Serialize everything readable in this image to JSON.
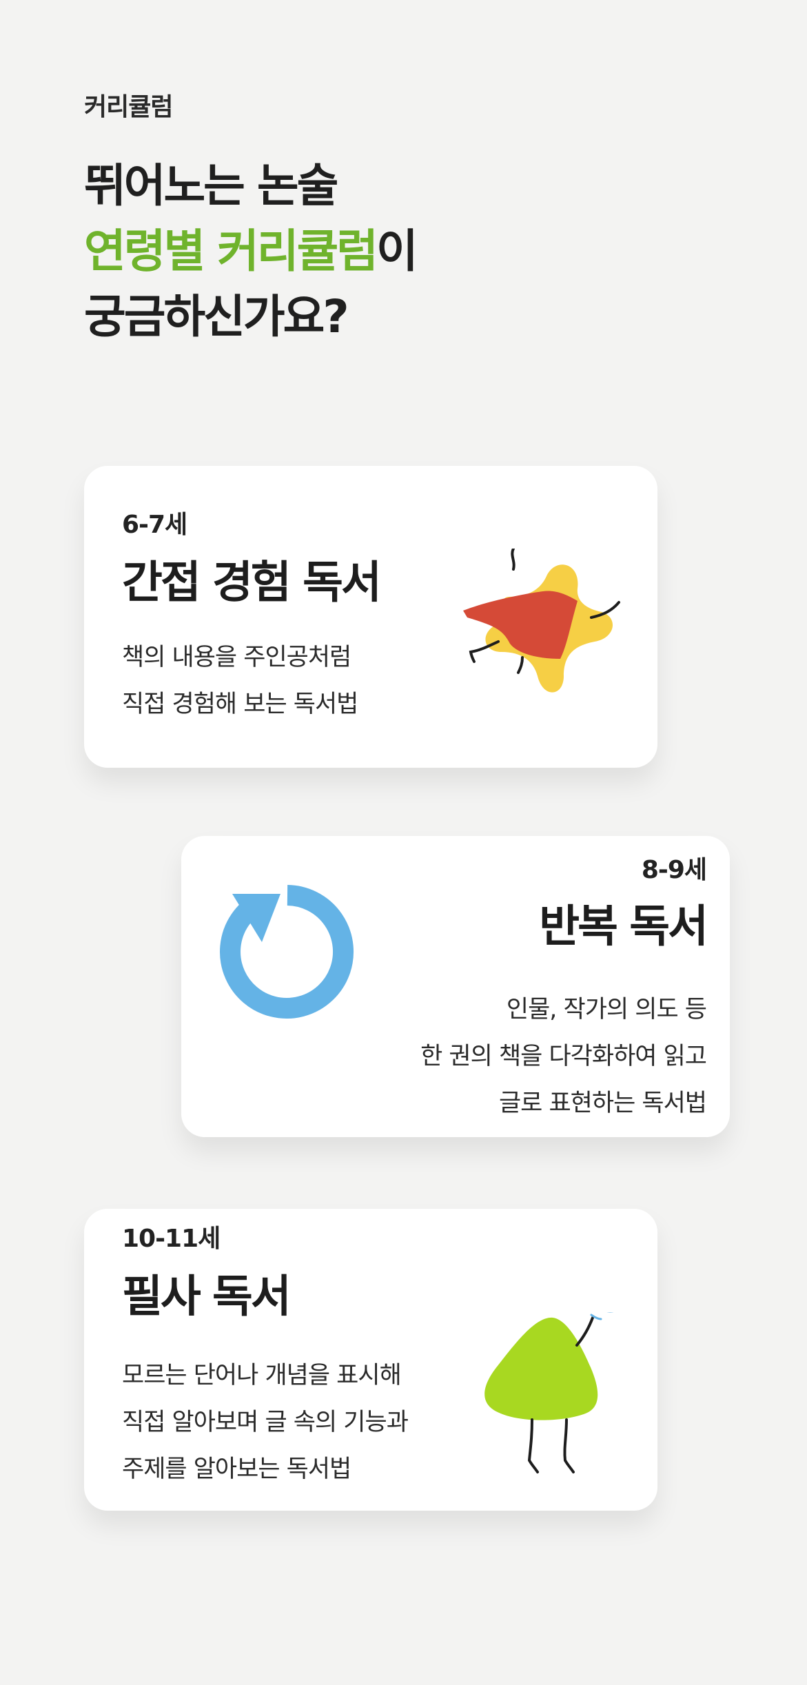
{
  "header": {
    "eyebrow": "커리큘럼",
    "line1": "뛰어노는 논술",
    "line2_accent": "연령별 커리큘럼",
    "line2_rest": "이",
    "line3": "궁금하신가요?",
    "accent_color": "#6fb32c"
  },
  "cards": [
    {
      "age": "6-7세",
      "title": "간접 경험 독서",
      "desc": [
        "책의 내용을 주인공처럼",
        "직접 경험해 보는 독서법"
      ],
      "icon": "star-character-icon"
    },
    {
      "age": "8-9세",
      "title": "반복 독서",
      "desc": [
        "인물, 작가의 의도 등",
        "한 권의 책을 다각화하여 읽고",
        "글로 표현하는 독서법"
      ],
      "icon": "repeat-arrow-icon"
    },
    {
      "age": "10-11세",
      "title": "필사 독서",
      "desc": [
        "모르는 단어나 개념을 표시해",
        "직접 알아보며 글 속의 기능과",
        "주제를 알아보는 독서법"
      ],
      "icon": "triangle-character-icon"
    }
  ],
  "colors": {
    "background": "#f3f3f2",
    "star_yellow": "#f6cf45",
    "cape_red": "#d54a37",
    "repeat_blue": "#64b3e6",
    "character_green": "#a8d821"
  }
}
